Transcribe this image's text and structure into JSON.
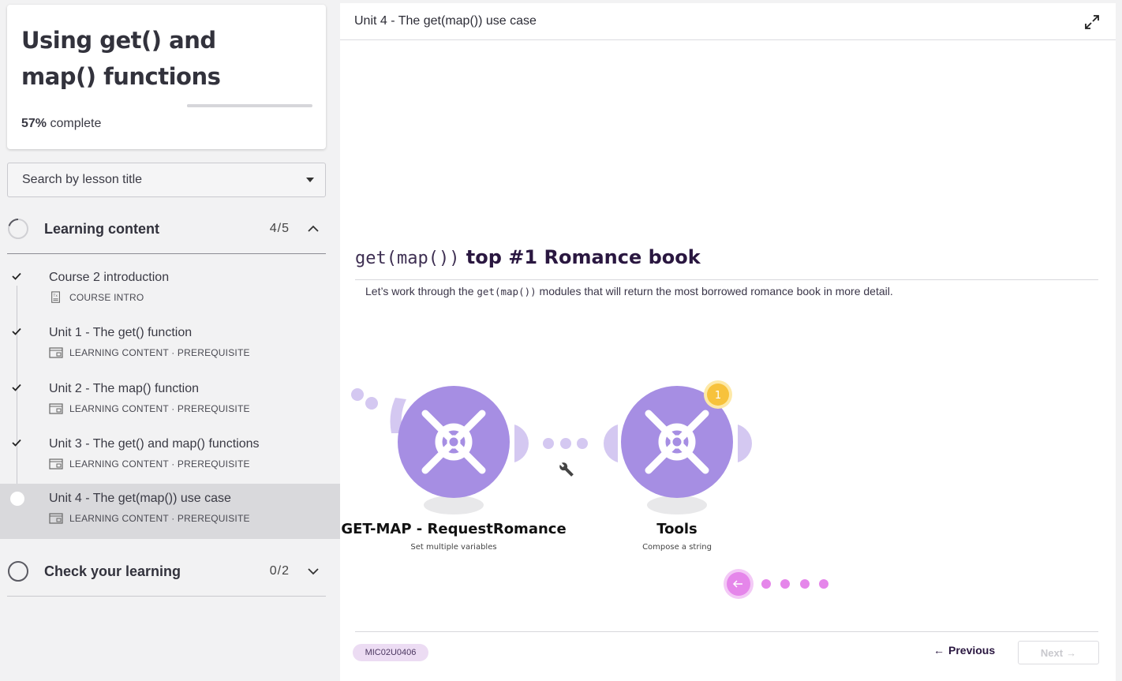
{
  "course": {
    "title": "Using get() and map() functions",
    "progress_value": "57%",
    "progress_suffix": " complete",
    "progress_fraction": 0.57
  },
  "search": {
    "placeholder": "Search by lesson title"
  },
  "sections": [
    {
      "title": "Learning content",
      "count": "4/5",
      "lessons": [
        {
          "title": "Course 2 introduction",
          "meta": "COURSE INTRO",
          "done": true
        },
        {
          "title": "Unit 1 - The get() function",
          "meta": "LEARNING CONTENT · PREREQUISITE",
          "done": true
        },
        {
          "title": "Unit 2 - The map() function",
          "meta": "LEARNING CONTENT · PREREQUISITE",
          "done": true
        },
        {
          "title": "Unit 3 - The get() and map() functions",
          "meta": "LEARNING CONTENT · PREREQUISITE",
          "done": true
        },
        {
          "title": "Unit 4 - The get(map()) use case",
          "meta": "LEARNING CONTENT · PREREQUISITE",
          "done": false,
          "active": true
        }
      ]
    },
    {
      "title": "Check your learning",
      "count": "0/2"
    }
  ],
  "main": {
    "header_title": "Unit 4 - The get(map()) use case",
    "heading_code": "get(map())",
    "heading_text": " top #1 Romance book",
    "para_before": "Let’s work through the ",
    "para_code": "get(map())",
    "para_after": " modules that will return the most borrowed romance book in more detail.",
    "diagram": {
      "module1_title": "GET-MAP - RequestRomance",
      "module1_sub": "Set multiple variables",
      "module2_title": "Tools",
      "module2_sub": "Compose a string",
      "badge": "1",
      "module_color": "#a68ee3",
      "halo_color": "#d4c8f1",
      "pager_color": "#e586ea"
    },
    "code_badge": "MIC02U0406",
    "prev_label": "Previous",
    "next_label": "Next"
  }
}
